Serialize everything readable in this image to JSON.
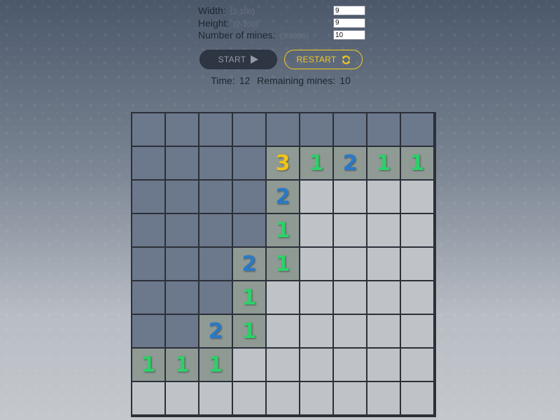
{
  "settings": {
    "width": {
      "label": "Width:",
      "hint": "(2-100)",
      "value": "9"
    },
    "height": {
      "label": "Height:",
      "hint": "(2-100)",
      "value": "9"
    },
    "mines": {
      "label": "Number of mines:",
      "hint": "(3-9999)",
      "value": "10"
    }
  },
  "buttons": {
    "start_label": "START",
    "start_icon": "play-icon",
    "restart_label": "RESTART",
    "restart_icon": "refresh-icon"
  },
  "status": {
    "time_label": "Time:",
    "time_value": "12",
    "remaining_label": "Remaining mines:",
    "remaining_value": "10"
  },
  "colors": {
    "hidden_cell": "#6c788b",
    "revealed_cell": "#bfc3c7",
    "numbered_cell": "#8f9a94",
    "number_1": "#2ed06a",
    "number_2": "#2a79c8",
    "number_3": "#f1c21a",
    "restart_accent": "#f5cb1f"
  },
  "board": {
    "rows": [
      [
        "H",
        "H",
        "H",
        "H",
        "H",
        "H",
        "H",
        "H",
        "H"
      ],
      [
        "H",
        "H",
        "H",
        "H",
        "3",
        "1",
        "2",
        "1",
        "1"
      ],
      [
        "H",
        "H",
        "H",
        "H",
        "2",
        "0",
        "0",
        "0",
        "0"
      ],
      [
        "H",
        "H",
        "H",
        "H",
        "1",
        "0",
        "0",
        "0",
        "0"
      ],
      [
        "H",
        "H",
        "H",
        "2",
        "1",
        "0",
        "0",
        "0",
        "0"
      ],
      [
        "H",
        "H",
        "H",
        "1",
        "0",
        "0",
        "0",
        "0",
        "0"
      ],
      [
        "H",
        "H",
        "2",
        "1",
        "0",
        "0",
        "0",
        "0",
        "0"
      ],
      [
        "1",
        "1",
        "1",
        "0",
        "0",
        "0",
        "0",
        "0",
        "0"
      ],
      [
        "0",
        "0",
        "0",
        "0",
        "0",
        "0",
        "0",
        "0",
        "0"
      ]
    ]
  }
}
